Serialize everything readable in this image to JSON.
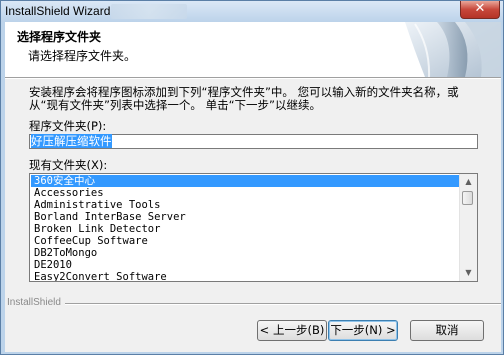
{
  "window": {
    "title": "InstallShield Wizard",
    "close_glyph": "✕"
  },
  "header": {
    "title": "选择程序文件夹",
    "subtitle": "请选择程序文件夹。"
  },
  "body": {
    "description": "安装程序会将程序图标添加到下列“程序文件夹”中。 您可以输入新的文件夹名称，或从“现有文件夹”列表中选择一个。 单击“下一步”以继续。",
    "program_folder_label": "程序文件夹(P):",
    "program_folder_value": "好压解压缩软件",
    "existing_folders_label": "现有文件夹(X):",
    "existing_folders": [
      "360安全中心",
      "Accessories",
      "Administrative Tools",
      "Borland InterBase Server",
      "Broken Link Detector",
      "CoffeeCup Software",
      "DB2ToMongo",
      "DE2010",
      "Easy2Convert Software"
    ],
    "selected_index": 0
  },
  "footer": {
    "brand": "InstallShield",
    "back_label": "< 上一步(B)",
    "next_label": "下一步(N) >",
    "cancel_label": "取消"
  },
  "icons": {
    "close": "close-icon",
    "scroll_up": "scroll-up-icon",
    "scroll_down": "scroll-down-icon",
    "header_graphic": "setup-graphic-icon"
  }
}
